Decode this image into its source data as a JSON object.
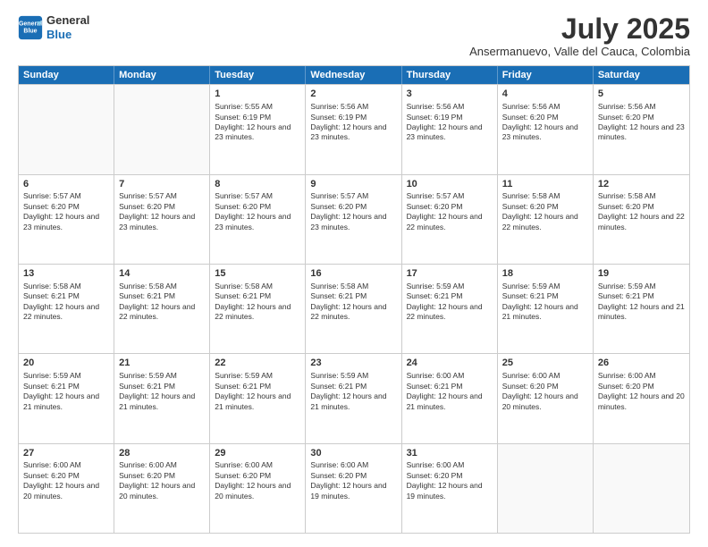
{
  "logo": {
    "line1": "General",
    "line2": "Blue"
  },
  "title": "July 2025",
  "location": "Ansermanuevo, Valle del Cauca, Colombia",
  "header_days": [
    "Sunday",
    "Monday",
    "Tuesday",
    "Wednesday",
    "Thursday",
    "Friday",
    "Saturday"
  ],
  "weeks": [
    [
      {
        "day": "",
        "info": ""
      },
      {
        "day": "",
        "info": ""
      },
      {
        "day": "1",
        "info": "Sunrise: 5:55 AM\nSunset: 6:19 PM\nDaylight: 12 hours and 23 minutes."
      },
      {
        "day": "2",
        "info": "Sunrise: 5:56 AM\nSunset: 6:19 PM\nDaylight: 12 hours and 23 minutes."
      },
      {
        "day": "3",
        "info": "Sunrise: 5:56 AM\nSunset: 6:19 PM\nDaylight: 12 hours and 23 minutes."
      },
      {
        "day": "4",
        "info": "Sunrise: 5:56 AM\nSunset: 6:20 PM\nDaylight: 12 hours and 23 minutes."
      },
      {
        "day": "5",
        "info": "Sunrise: 5:56 AM\nSunset: 6:20 PM\nDaylight: 12 hours and 23 minutes."
      }
    ],
    [
      {
        "day": "6",
        "info": "Sunrise: 5:57 AM\nSunset: 6:20 PM\nDaylight: 12 hours and 23 minutes."
      },
      {
        "day": "7",
        "info": "Sunrise: 5:57 AM\nSunset: 6:20 PM\nDaylight: 12 hours and 23 minutes."
      },
      {
        "day": "8",
        "info": "Sunrise: 5:57 AM\nSunset: 6:20 PM\nDaylight: 12 hours and 23 minutes."
      },
      {
        "day": "9",
        "info": "Sunrise: 5:57 AM\nSunset: 6:20 PM\nDaylight: 12 hours and 23 minutes."
      },
      {
        "day": "10",
        "info": "Sunrise: 5:57 AM\nSunset: 6:20 PM\nDaylight: 12 hours and 22 minutes."
      },
      {
        "day": "11",
        "info": "Sunrise: 5:58 AM\nSunset: 6:20 PM\nDaylight: 12 hours and 22 minutes."
      },
      {
        "day": "12",
        "info": "Sunrise: 5:58 AM\nSunset: 6:20 PM\nDaylight: 12 hours and 22 minutes."
      }
    ],
    [
      {
        "day": "13",
        "info": "Sunrise: 5:58 AM\nSunset: 6:21 PM\nDaylight: 12 hours and 22 minutes."
      },
      {
        "day": "14",
        "info": "Sunrise: 5:58 AM\nSunset: 6:21 PM\nDaylight: 12 hours and 22 minutes."
      },
      {
        "day": "15",
        "info": "Sunrise: 5:58 AM\nSunset: 6:21 PM\nDaylight: 12 hours and 22 minutes."
      },
      {
        "day": "16",
        "info": "Sunrise: 5:58 AM\nSunset: 6:21 PM\nDaylight: 12 hours and 22 minutes."
      },
      {
        "day": "17",
        "info": "Sunrise: 5:59 AM\nSunset: 6:21 PM\nDaylight: 12 hours and 22 minutes."
      },
      {
        "day": "18",
        "info": "Sunrise: 5:59 AM\nSunset: 6:21 PM\nDaylight: 12 hours and 21 minutes."
      },
      {
        "day": "19",
        "info": "Sunrise: 5:59 AM\nSunset: 6:21 PM\nDaylight: 12 hours and 21 minutes."
      }
    ],
    [
      {
        "day": "20",
        "info": "Sunrise: 5:59 AM\nSunset: 6:21 PM\nDaylight: 12 hours and 21 minutes."
      },
      {
        "day": "21",
        "info": "Sunrise: 5:59 AM\nSunset: 6:21 PM\nDaylight: 12 hours and 21 minutes."
      },
      {
        "day": "22",
        "info": "Sunrise: 5:59 AM\nSunset: 6:21 PM\nDaylight: 12 hours and 21 minutes."
      },
      {
        "day": "23",
        "info": "Sunrise: 5:59 AM\nSunset: 6:21 PM\nDaylight: 12 hours and 21 minutes."
      },
      {
        "day": "24",
        "info": "Sunrise: 6:00 AM\nSunset: 6:21 PM\nDaylight: 12 hours and 21 minutes."
      },
      {
        "day": "25",
        "info": "Sunrise: 6:00 AM\nSunset: 6:20 PM\nDaylight: 12 hours and 20 minutes."
      },
      {
        "day": "26",
        "info": "Sunrise: 6:00 AM\nSunset: 6:20 PM\nDaylight: 12 hours and 20 minutes."
      }
    ],
    [
      {
        "day": "27",
        "info": "Sunrise: 6:00 AM\nSunset: 6:20 PM\nDaylight: 12 hours and 20 minutes."
      },
      {
        "day": "28",
        "info": "Sunrise: 6:00 AM\nSunset: 6:20 PM\nDaylight: 12 hours and 20 minutes."
      },
      {
        "day": "29",
        "info": "Sunrise: 6:00 AM\nSunset: 6:20 PM\nDaylight: 12 hours and 20 minutes."
      },
      {
        "day": "30",
        "info": "Sunrise: 6:00 AM\nSunset: 6:20 PM\nDaylight: 12 hours and 19 minutes."
      },
      {
        "day": "31",
        "info": "Sunrise: 6:00 AM\nSunset: 6:20 PM\nDaylight: 12 hours and 19 minutes."
      },
      {
        "day": "",
        "info": ""
      },
      {
        "day": "",
        "info": ""
      }
    ]
  ]
}
